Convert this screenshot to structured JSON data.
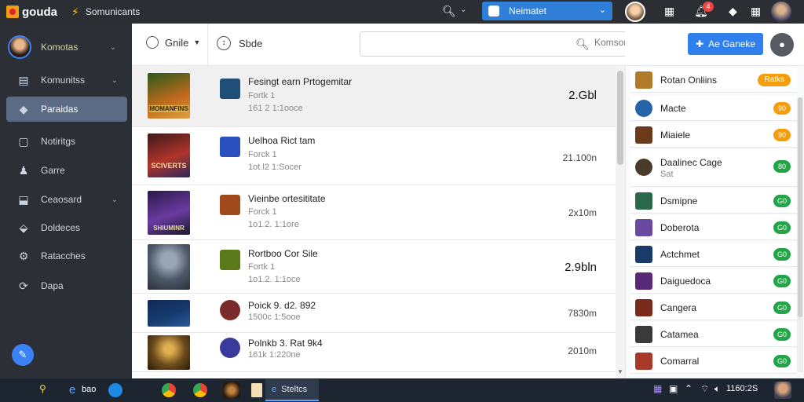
{
  "app": {
    "brand": "gouda",
    "community": "Somunicants"
  },
  "top": {
    "select_label": "Neimatet",
    "notif_count": "4"
  },
  "sidebar": {
    "profile_name": "Komotas",
    "items": [
      {
        "label": "Komunitss",
        "icon": "library-icon",
        "has_chevron": true
      },
      {
        "label": "Paraidas",
        "icon": "tag-icon",
        "active": true
      },
      {
        "label": "Notiritgs",
        "icon": "bell-icon"
      },
      {
        "label": "Garre",
        "icon": "user-icon"
      },
      {
        "label": "Ceaosard",
        "icon": "download-icon",
        "has_chevron": true
      },
      {
        "label": "Doldeces",
        "icon": "puzzle-icon"
      },
      {
        "label": "Ratacches",
        "icon": "gear-icon"
      },
      {
        "label": "Dapa",
        "icon": "refresh-icon"
      }
    ]
  },
  "filter": {
    "label": "Gnile",
    "sort_label": "Sbde"
  },
  "search": {
    "placeholder": "Komsoniitas",
    "add_symbol": "+"
  },
  "actions": {
    "add_label": "Ae Ganeke"
  },
  "games": [
    {
      "cover_text": "MOMANFINS",
      "cover_color": "#c56a1c",
      "icon_color": "#1f4e79",
      "title": "Fesingt earn Prtogemitar",
      "sub1": "Fortk 1",
      "sub2": "161 2 1:1ooce",
      "value": "2.Gbl",
      "big": true,
      "highlight": true
    },
    {
      "cover_text": "SCIVERTS",
      "cover_color": "#b0342a",
      "icon_color": "#2a4fbf",
      "title": "Uelhoa Rict tam",
      "sub1": "Forck 1",
      "sub2": "1ot.l2 1:Socer",
      "value": "21.100n"
    },
    {
      "cover_text": "SHIUMINR",
      "cover_color": "#4b2a7a",
      "icon_color": "#a04a1e",
      "title": "Vieinbe ortesititate",
      "sub1": "Forck 1",
      "sub2": "1o1.2. 1:1ore",
      "value": "2x10m"
    },
    {
      "cover_text": "",
      "cover_color": "#4c5868",
      "icon_color": "#5a7a1a",
      "title": "Rortboo Cor Sile",
      "sub1": "Fortk 1",
      "sub2": "1o1.2. 1:1oce",
      "value": "2.9bln",
      "big": true
    },
    {
      "cover_text": "",
      "cover_color": "#173a6e",
      "icon_color": "#7a2a2a",
      "title": "Poick 9. d2. 892",
      "sub1": "1500c 1:5ooe",
      "sub2": "",
      "value": "7830m"
    },
    {
      "cover_text": "",
      "cover_color": "#6b4a1c",
      "icon_color": "#3a3a9a",
      "title": "Polnkb 3. Rat 9k4",
      "sub1": "161k 1:220ne",
      "sub2": "",
      "value": "2010m"
    }
  ],
  "friends": [
    {
      "name": "Rotan Onliins",
      "pill": "Ratks",
      "pill_color": "orange",
      "avatar": "#b07a2a"
    },
    {
      "name": "Macte",
      "pill": "90",
      "pill_color": "orange",
      "avatar": "#2563a8"
    },
    {
      "name": "Miaiele",
      "pill": "90",
      "pill_color": "orange",
      "avatar": "#6b3a1a"
    },
    {
      "name": "Daalinec Cage",
      "sub": "Sat",
      "pill": "80",
      "pill_color": "green",
      "avatar": "#4a3a2a"
    },
    {
      "name": "Dsmipne",
      "pill": "G0",
      "pill_color": "green",
      "avatar": "#2a6a4a"
    },
    {
      "name": "Doberota",
      "pill": "G0",
      "pill_color": "green",
      "avatar": "#6a4aa0"
    },
    {
      "name": "Actchmet",
      "pill": "G0",
      "pill_color": "green",
      "avatar": "#1a3a6a"
    },
    {
      "name": "Daiguedoca",
      "pill": "G0",
      "pill_color": "green",
      "avatar": "#5a2a7a"
    },
    {
      "name": "Cangera",
      "pill": "G0",
      "pill_color": "green",
      "avatar": "#7a2a1a"
    },
    {
      "name": "Catamea",
      "pill": "G0",
      "pill_color": "green",
      "avatar": "#3a3a3a"
    },
    {
      "name": "Comarral",
      "pill": "G0",
      "pill_color": "green",
      "avatar": "#a83a2a"
    }
  ],
  "taskbar": {
    "browser_label": "bao",
    "active_label": "Steltcs",
    "clock": "1160:2S"
  }
}
